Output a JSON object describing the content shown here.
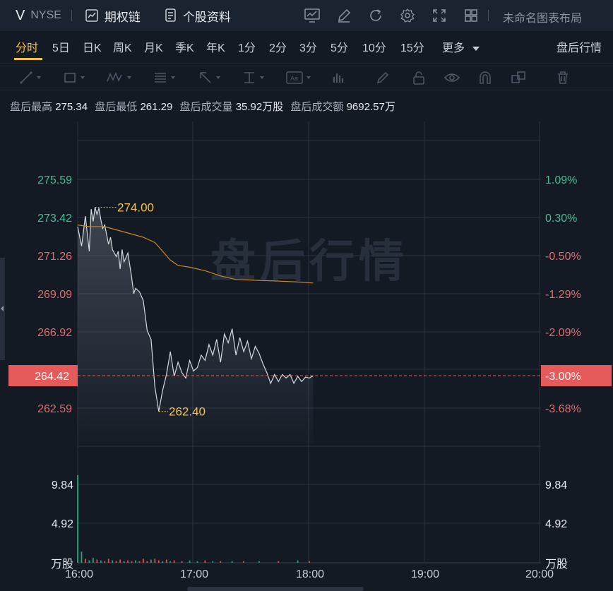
{
  "header": {
    "ticker": "V",
    "exchange": "NYSE",
    "options_chain_label": "期权链",
    "stock_info_label": "个股资料",
    "layout_name": "未命名图表布局"
  },
  "tabs": {
    "items": [
      {
        "label": "分时",
        "active": true
      },
      {
        "label": "5日"
      },
      {
        "label": "日K"
      },
      {
        "label": "周K"
      },
      {
        "label": "月K"
      },
      {
        "label": "季K"
      },
      {
        "label": "年K"
      },
      {
        "label": "1分"
      },
      {
        "label": "2分"
      },
      {
        "label": "3分"
      },
      {
        "label": "5分"
      },
      {
        "label": "10分"
      },
      {
        "label": "15分"
      },
      {
        "label": "更多"
      }
    ],
    "after_hours_label": "盘后行情"
  },
  "summary": {
    "high_label": "盘后最高",
    "high": "275.34",
    "low_label": "盘后最低",
    "low": "261.29",
    "volume_label": "盘后成交量",
    "volume": "35.92万股",
    "turnover_label": "盘后成交额",
    "turnover": "9692.57万"
  },
  "chart_data": {
    "type": "line",
    "watermark": "盘后行情",
    "price_axis": [
      "275.59",
      "273.42",
      "271.26",
      "269.09",
      "266.92",
      "264.42",
      "262.59"
    ],
    "percent_axis": [
      "1.09%",
      "0.30%",
      "-0.50%",
      "-1.29%",
      "-2.09%",
      "-3.00%",
      "-3.68%"
    ],
    "ylim": [
      261.5,
      277.0
    ],
    "current_price": "264.42",
    "current_percent": "-3.00%",
    "high_marker": "274.00",
    "low_marker": "262.40",
    "x_labels": [
      "16:00",
      "17:00",
      "18:00",
      "19:00",
      "20:00"
    ],
    "x_range_minutes": [
      0,
      240
    ],
    "volume_axis": [
      "9.84",
      "4.92"
    ],
    "volume_unit": "万股",
    "volume_max": 11.2,
    "colors": {
      "up": "#1fa77b",
      "down": "#e04f4f",
      "price_line": "#d5d9e0",
      "avg_line": "#c9862a",
      "marker": "#f3c342",
      "current_box": "#e55a5a"
    },
    "price_series": [
      {
        "t": 0,
        "p": 272.9
      },
      {
        "t": 2,
        "p": 271.8
      },
      {
        "t": 4,
        "p": 273.5
      },
      {
        "t": 6,
        "p": 271.5
      },
      {
        "t": 7,
        "p": 273.9
      },
      {
        "t": 8,
        "p": 273.2
      },
      {
        "t": 9,
        "p": 274.0
      },
      {
        "t": 10,
        "p": 273.6
      },
      {
        "t": 11,
        "p": 273.95
      },
      {
        "t": 12,
        "p": 273.3
      },
      {
        "t": 13,
        "p": 272.8
      },
      {
        "t": 14,
        "p": 273.0
      },
      {
        "t": 16,
        "p": 271.9
      },
      {
        "t": 17,
        "p": 272.3
      },
      {
        "t": 18,
        "p": 271.6
      },
      {
        "t": 20,
        "p": 271.2
      },
      {
        "t": 21,
        "p": 271.5
      },
      {
        "t": 22,
        "p": 270.5
      },
      {
        "t": 23,
        "p": 271.6
      },
      {
        "t": 24,
        "p": 270.9
      },
      {
        "t": 26,
        "p": 271.4
      },
      {
        "t": 28,
        "p": 270.0
      },
      {
        "t": 29,
        "p": 269.1
      },
      {
        "t": 30,
        "p": 269.4
      },
      {
        "t": 32,
        "p": 269.2
      },
      {
        "t": 34,
        "p": 268.7
      },
      {
        "t": 36,
        "p": 267.0
      },
      {
        "t": 38,
        "p": 266.5
      },
      {
        "t": 40,
        "p": 263.8
      },
      {
        "t": 42,
        "p": 262.4
      },
      {
        "t": 44,
        "p": 263.6
      },
      {
        "t": 46,
        "p": 264.5
      },
      {
        "t": 48,
        "p": 265.8
      },
      {
        "t": 50,
        "p": 264.4
      },
      {
        "t": 52,
        "p": 265.2
      },
      {
        "t": 54,
        "p": 264.6
      },
      {
        "t": 56,
        "p": 264.3
      },
      {
        "t": 58,
        "p": 265.3
      },
      {
        "t": 60,
        "p": 264.7
      },
      {
        "t": 62,
        "p": 264.9
      },
      {
        "t": 64,
        "p": 265.6
      },
      {
        "t": 66,
        "p": 265.3
      },
      {
        "t": 68,
        "p": 266.2
      },
      {
        "t": 70,
        "p": 265.6
      },
      {
        "t": 72,
        "p": 266.5
      },
      {
        "t": 74,
        "p": 265.2
      },
      {
        "t": 76,
        "p": 266.8
      },
      {
        "t": 78,
        "p": 266.3
      },
      {
        "t": 80,
        "p": 267.1
      },
      {
        "t": 82,
        "p": 265.6
      },
      {
        "t": 84,
        "p": 266.6
      },
      {
        "t": 86,
        "p": 265.8
      },
      {
        "t": 88,
        "p": 266.4
      },
      {
        "t": 90,
        "p": 265.4
      },
      {
        "t": 92,
        "p": 266.1
      },
      {
        "t": 94,
        "p": 265.7
      },
      {
        "t": 96,
        "p": 265.1
      },
      {
        "t": 98,
        "p": 264.6
      },
      {
        "t": 100,
        "p": 264.0
      },
      {
        "t": 102,
        "p": 264.5
      },
      {
        "t": 104,
        "p": 264.1
      },
      {
        "t": 106,
        "p": 264.5
      },
      {
        "t": 108,
        "p": 264.3
      },
      {
        "t": 110,
        "p": 264.5
      },
      {
        "t": 112,
        "p": 264.0
      },
      {
        "t": 114,
        "p": 264.4
      },
      {
        "t": 116,
        "p": 264.1
      },
      {
        "t": 118,
        "p": 264.35
      },
      {
        "t": 120,
        "p": 264.3
      },
      {
        "t": 122,
        "p": 264.42
      }
    ],
    "avg_series": [
      {
        "t": 0,
        "p": 273.0
      },
      {
        "t": 6,
        "p": 272.9
      },
      {
        "t": 14,
        "p": 272.9
      },
      {
        "t": 24,
        "p": 272.6
      },
      {
        "t": 34,
        "p": 272.3
      },
      {
        "t": 40,
        "p": 272.0
      },
      {
        "t": 44,
        "p": 271.5
      },
      {
        "t": 48,
        "p": 271.0
      },
      {
        "t": 52,
        "p": 270.7
      },
      {
        "t": 58,
        "p": 270.6
      },
      {
        "t": 66,
        "p": 270.4
      },
      {
        "t": 74,
        "p": 270.1
      },
      {
        "t": 82,
        "p": 269.9
      },
      {
        "t": 94,
        "p": 269.85
      },
      {
        "t": 106,
        "p": 269.8
      },
      {
        "t": 116,
        "p": 269.75
      },
      {
        "t": 122,
        "p": 269.7
      }
    ],
    "volume_series": [
      {
        "t": 0,
        "v": 11.0,
        "c": "up"
      },
      {
        "t": 2,
        "v": 1.4,
        "c": "up"
      },
      {
        "t": 4,
        "v": 0.5,
        "c": "down"
      },
      {
        "t": 6,
        "v": 0.3,
        "c": "up"
      },
      {
        "t": 8,
        "v": 0.6,
        "c": "up"
      },
      {
        "t": 10,
        "v": 0.4,
        "c": "down"
      },
      {
        "t": 12,
        "v": 0.3,
        "c": "up"
      },
      {
        "t": 14,
        "v": 0.2,
        "c": "down"
      },
      {
        "t": 16,
        "v": 0.5,
        "c": "down"
      },
      {
        "t": 18,
        "v": 0.3,
        "c": "up"
      },
      {
        "t": 20,
        "v": 0.2,
        "c": "down"
      },
      {
        "t": 22,
        "v": 0.4,
        "c": "down"
      },
      {
        "t": 24,
        "v": 0.2,
        "c": "up"
      },
      {
        "t": 26,
        "v": 0.3,
        "c": "down"
      },
      {
        "t": 28,
        "v": 0.2,
        "c": "down"
      },
      {
        "t": 30,
        "v": 0.3,
        "c": "up"
      },
      {
        "t": 32,
        "v": 0.2,
        "c": "down"
      },
      {
        "t": 34,
        "v": 0.5,
        "c": "down"
      },
      {
        "t": 36,
        "v": 0.2,
        "c": "down"
      },
      {
        "t": 38,
        "v": 0.4,
        "c": "up"
      },
      {
        "t": 40,
        "v": 0.5,
        "c": "down"
      },
      {
        "t": 42,
        "v": 0.3,
        "c": "down"
      },
      {
        "t": 44,
        "v": 0.2,
        "c": "up"
      },
      {
        "t": 46,
        "v": 0.4,
        "c": "down"
      },
      {
        "t": 48,
        "v": 0.2,
        "c": "up"
      },
      {
        "t": 50,
        "v": 0.3,
        "c": "down"
      },
      {
        "t": 54,
        "v": 0.2,
        "c": "down"
      },
      {
        "t": 58,
        "v": 0.3,
        "c": "up"
      },
      {
        "t": 62,
        "v": 0.2,
        "c": "up"
      },
      {
        "t": 66,
        "v": 0.3,
        "c": "down"
      },
      {
        "t": 70,
        "v": 0.2,
        "c": "up"
      },
      {
        "t": 74,
        "v": 0.2,
        "c": "down"
      },
      {
        "t": 80,
        "v": 0.2,
        "c": "up"
      },
      {
        "t": 86,
        "v": 0.2,
        "c": "down"
      },
      {
        "t": 94,
        "v": 0.2,
        "c": "up"
      },
      {
        "t": 104,
        "v": 0.2,
        "c": "down"
      },
      {
        "t": 114,
        "v": 0.3,
        "c": "up"
      },
      {
        "t": 120,
        "v": 0.2,
        "c": "down"
      }
    ]
  }
}
